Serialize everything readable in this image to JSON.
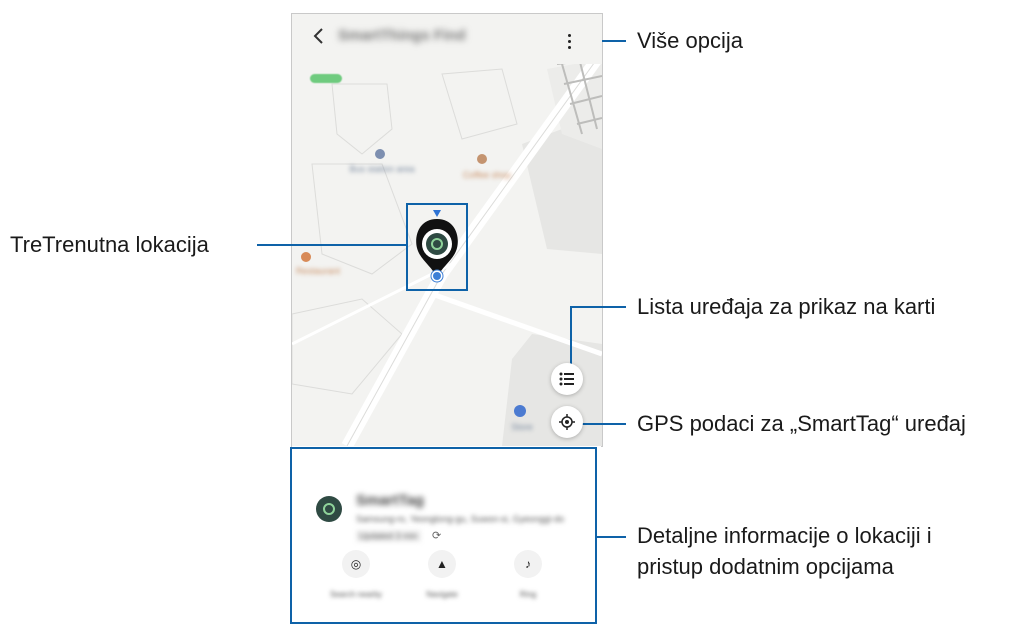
{
  "app": {
    "title": "SmartThings Find",
    "back_icon": "chevron-left-icon",
    "more_icon": "more-vertical-icon"
  },
  "map": {
    "poi_labels": [
      {
        "text": "Bus station area",
        "color": "#7a8aa0"
      },
      {
        "text": "Coffee shop",
        "color": "#c98d62"
      },
      {
        "text": "Restaurant",
        "color": "#c98d62"
      },
      {
        "text": "Store",
        "color": "#7a8aa0"
      }
    ]
  },
  "buttons": {
    "device_list_icon": "list-icon",
    "gps_icon": "locate-icon"
  },
  "sheet": {
    "device_name": "SmartTag",
    "address": "Samsung-ro, Yeongtong-gu, Suwon-si, Gyeonggi-do",
    "time": "Updated 3 min",
    "refresh_icon": "refresh-icon",
    "actions": [
      {
        "icon": "search-nearby-icon",
        "label": "Search nearby"
      },
      {
        "icon": "navigation-icon",
        "label": "Navigate"
      },
      {
        "icon": "ring-icon",
        "label": "Ring"
      }
    ]
  },
  "callouts": {
    "more_options": "Više opcija",
    "current_location": "TreTrenutna lokacija",
    "device_list": "Lista uređaja za prikaz na karti",
    "gps": "GPS podaci za „SmartTag“ uređaj",
    "details_line1": "Detaljne informacije o lokaciji i",
    "details_line2": "pristup dodatnim opcijama"
  },
  "colors": {
    "accent": "#0e62a8",
    "map_bg": "#f3f3f1",
    "road": "#ffffff",
    "building": "#e4e4e2",
    "marker": "#2f4a43",
    "marker_ring": "#8fd39a",
    "location_dot": "#3d7fd6"
  }
}
